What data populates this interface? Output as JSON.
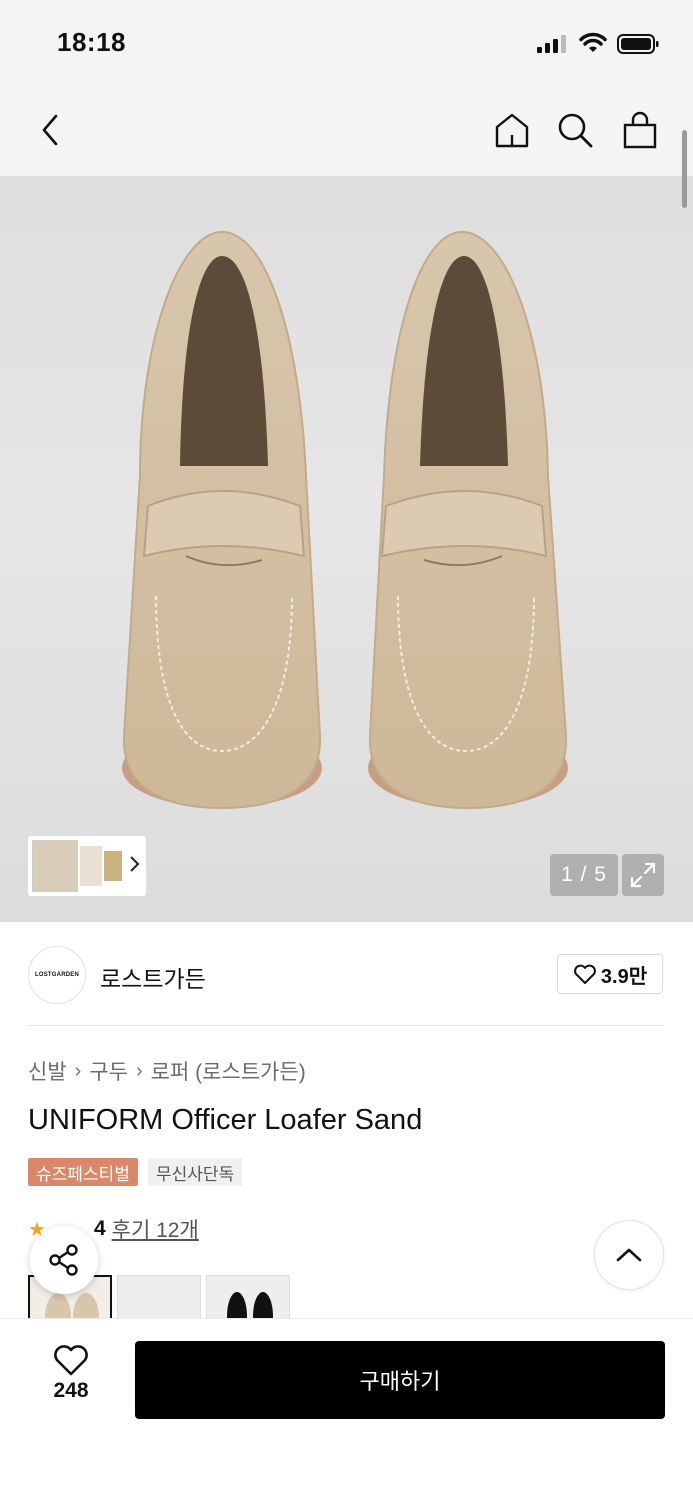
{
  "status_bar": {
    "time": "18:18"
  },
  "nav": {
    "back_icon": "chevron-left-icon",
    "home_icon": "home-icon",
    "search_icon": "search-icon",
    "cart_icon": "shopping-bag-icon"
  },
  "gallery": {
    "counter": "1 / 5",
    "expand_icon": "expand-icon"
  },
  "brand": {
    "logo_text": "LOSTGARDEN",
    "name": "로스트가든",
    "likes": "3.9만"
  },
  "breadcrumb": [
    "신발",
    "구두",
    "로퍼 (로스트가든)"
  ],
  "product": {
    "title": "UNIFORM Officer Loafer Sand",
    "badges": [
      "슈즈페스티벌",
      "무신사단독"
    ],
    "rating": "4",
    "reviews": "후기 12개"
  },
  "bottom_bar": {
    "wishlist_count": "248",
    "buy_label": "구매하기"
  },
  "colors": {
    "badge_fest": "#d9896a",
    "buy": "#000000"
  }
}
